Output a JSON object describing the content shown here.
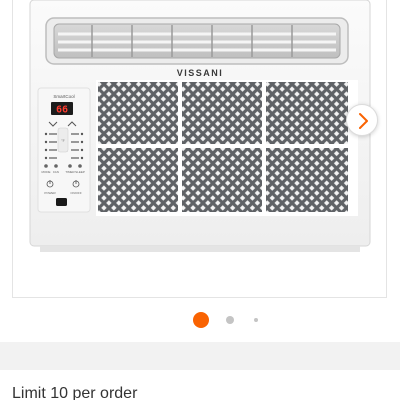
{
  "product": {
    "brand": "VISSANI",
    "display_readout": "66",
    "panel_header": "SmartCool",
    "panel_buttons": {
      "mode": "MODE",
      "fan": "FAN",
      "timer": "TIMER",
      "sleep": "SLEEP",
      "power": "POWER",
      "onoff": "ON/OFF"
    },
    "panel_indicators": [
      "Auto",
      "Cool",
      "Dry",
      "Fan",
      "Eco",
      "High",
      "Med",
      "Low"
    ]
  },
  "next_arrow": {
    "icon": "chevron-right-icon"
  },
  "carousel": {
    "active_index": 1,
    "count": 3,
    "active_color": "#f96302",
    "inactive_color": "#c4c4c4"
  },
  "limit": {
    "text": "Limit 10 per order"
  }
}
